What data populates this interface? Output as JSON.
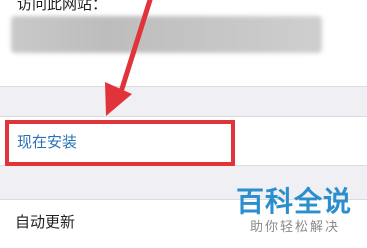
{
  "top_section": {
    "label": "访问此网站："
  },
  "install_row": {
    "label": "现在安装"
  },
  "update_row": {
    "label": "自动更新"
  },
  "watermark": {
    "title": "百科全说",
    "subtitle": "助你轻松解决"
  },
  "colors": {
    "highlight": "#e0343a",
    "link": "#2a72b5",
    "watermark": "#2b8fcd"
  }
}
